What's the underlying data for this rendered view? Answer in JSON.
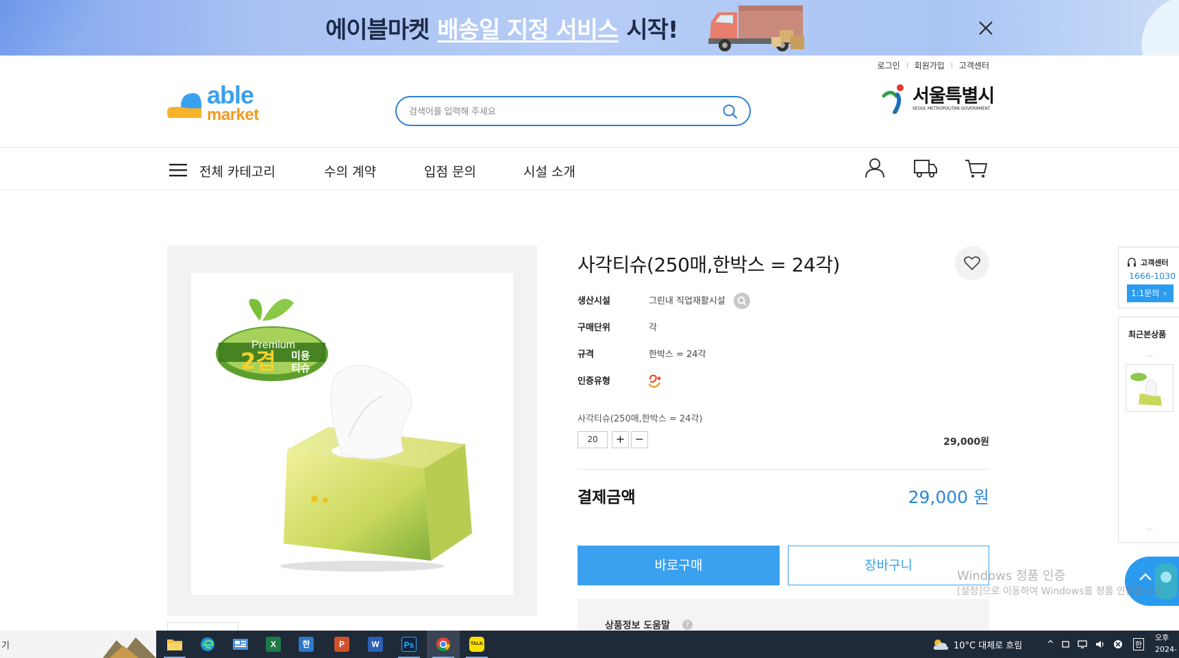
{
  "banner": {
    "text_pre": "에이블마켓",
    "text_highlight": "배송일 지정 서비스",
    "text_post": "시작!"
  },
  "util_links": [
    "로그인",
    "회원가입",
    "고객센터"
  ],
  "logo": {
    "line1": "able",
    "line2": "market"
  },
  "search": {
    "placeholder": "검색어를 입력해 주세요",
    "value": ""
  },
  "seoul": {
    "name": "서울특별시",
    "sub": "SEOUL METROPOLITAN GOVERNMENT"
  },
  "nav": {
    "items": [
      "전체 카테고리",
      "수의 계약",
      "입점 문의",
      "시설 소개"
    ]
  },
  "product": {
    "image_badge_top": "Premium",
    "image_badge_main": "2겹",
    "image_badge_sub1": "미용",
    "image_badge_sub2": "티슈",
    "title": "사각티슈(250매,한박스 = 24각)",
    "info": [
      {
        "key": "생산시설",
        "value": "그린내 직업재활시설"
      },
      {
        "key": "구매단위",
        "value": "각"
      },
      {
        "key": "규격",
        "value": "한박스 = 24각"
      },
      {
        "key": "인증유형",
        "value": ""
      }
    ],
    "option_name": "사각티슈(250매,한박스 = 24각)",
    "quantity": "20",
    "option_price": "29,000원",
    "total_label": "결제금액",
    "total_value": "29,000 원",
    "buy_label": "바로구매",
    "cart_label": "장바구니",
    "help_title": "상품정보 도움말",
    "help_q": "?"
  },
  "sidebar": {
    "cs_title": "고객센터",
    "cs_tel": "1666-1030",
    "cs_btn": "1:1문의",
    "recent_title": "최근본상품"
  },
  "watermark": {
    "line1": "Windows 정품 인증",
    "line2": "[설정]으로 이동하여 Windows를 정품 인증합니다."
  },
  "taskbar": {
    "search_text": "기",
    "apps": [
      {
        "name": "file-explorer",
        "label": "",
        "color": "#f0c040"
      },
      {
        "name": "edge",
        "label": "e",
        "color": "#1f8fd6"
      },
      {
        "name": "photo-viewer",
        "label": "",
        "color": "#4a90d9"
      },
      {
        "name": "excel",
        "label": "X",
        "color": "#1d7a45"
      },
      {
        "name": "hangul",
        "label": "한",
        "color": "#2d78c8"
      },
      {
        "name": "powerpoint",
        "label": "P",
        "color": "#d0502a"
      },
      {
        "name": "word",
        "label": "W",
        "color": "#2b5fb4"
      },
      {
        "name": "photoshop",
        "label": "Ps",
        "color": "#0d2740"
      },
      {
        "name": "chrome",
        "label": "",
        "color": "#ffffff"
      },
      {
        "name": "kakaotalk",
        "label": "TALK",
        "color": "#f9e000"
      }
    ],
    "weather": "10°C 대체로 흐림",
    "ime": "한",
    "clock_line1": "오후",
    "clock_line2": "2024-"
  },
  "colors": {
    "accent": "#3aa0f0",
    "price": "#2b86d8",
    "search_border": "#2a7fd4"
  }
}
